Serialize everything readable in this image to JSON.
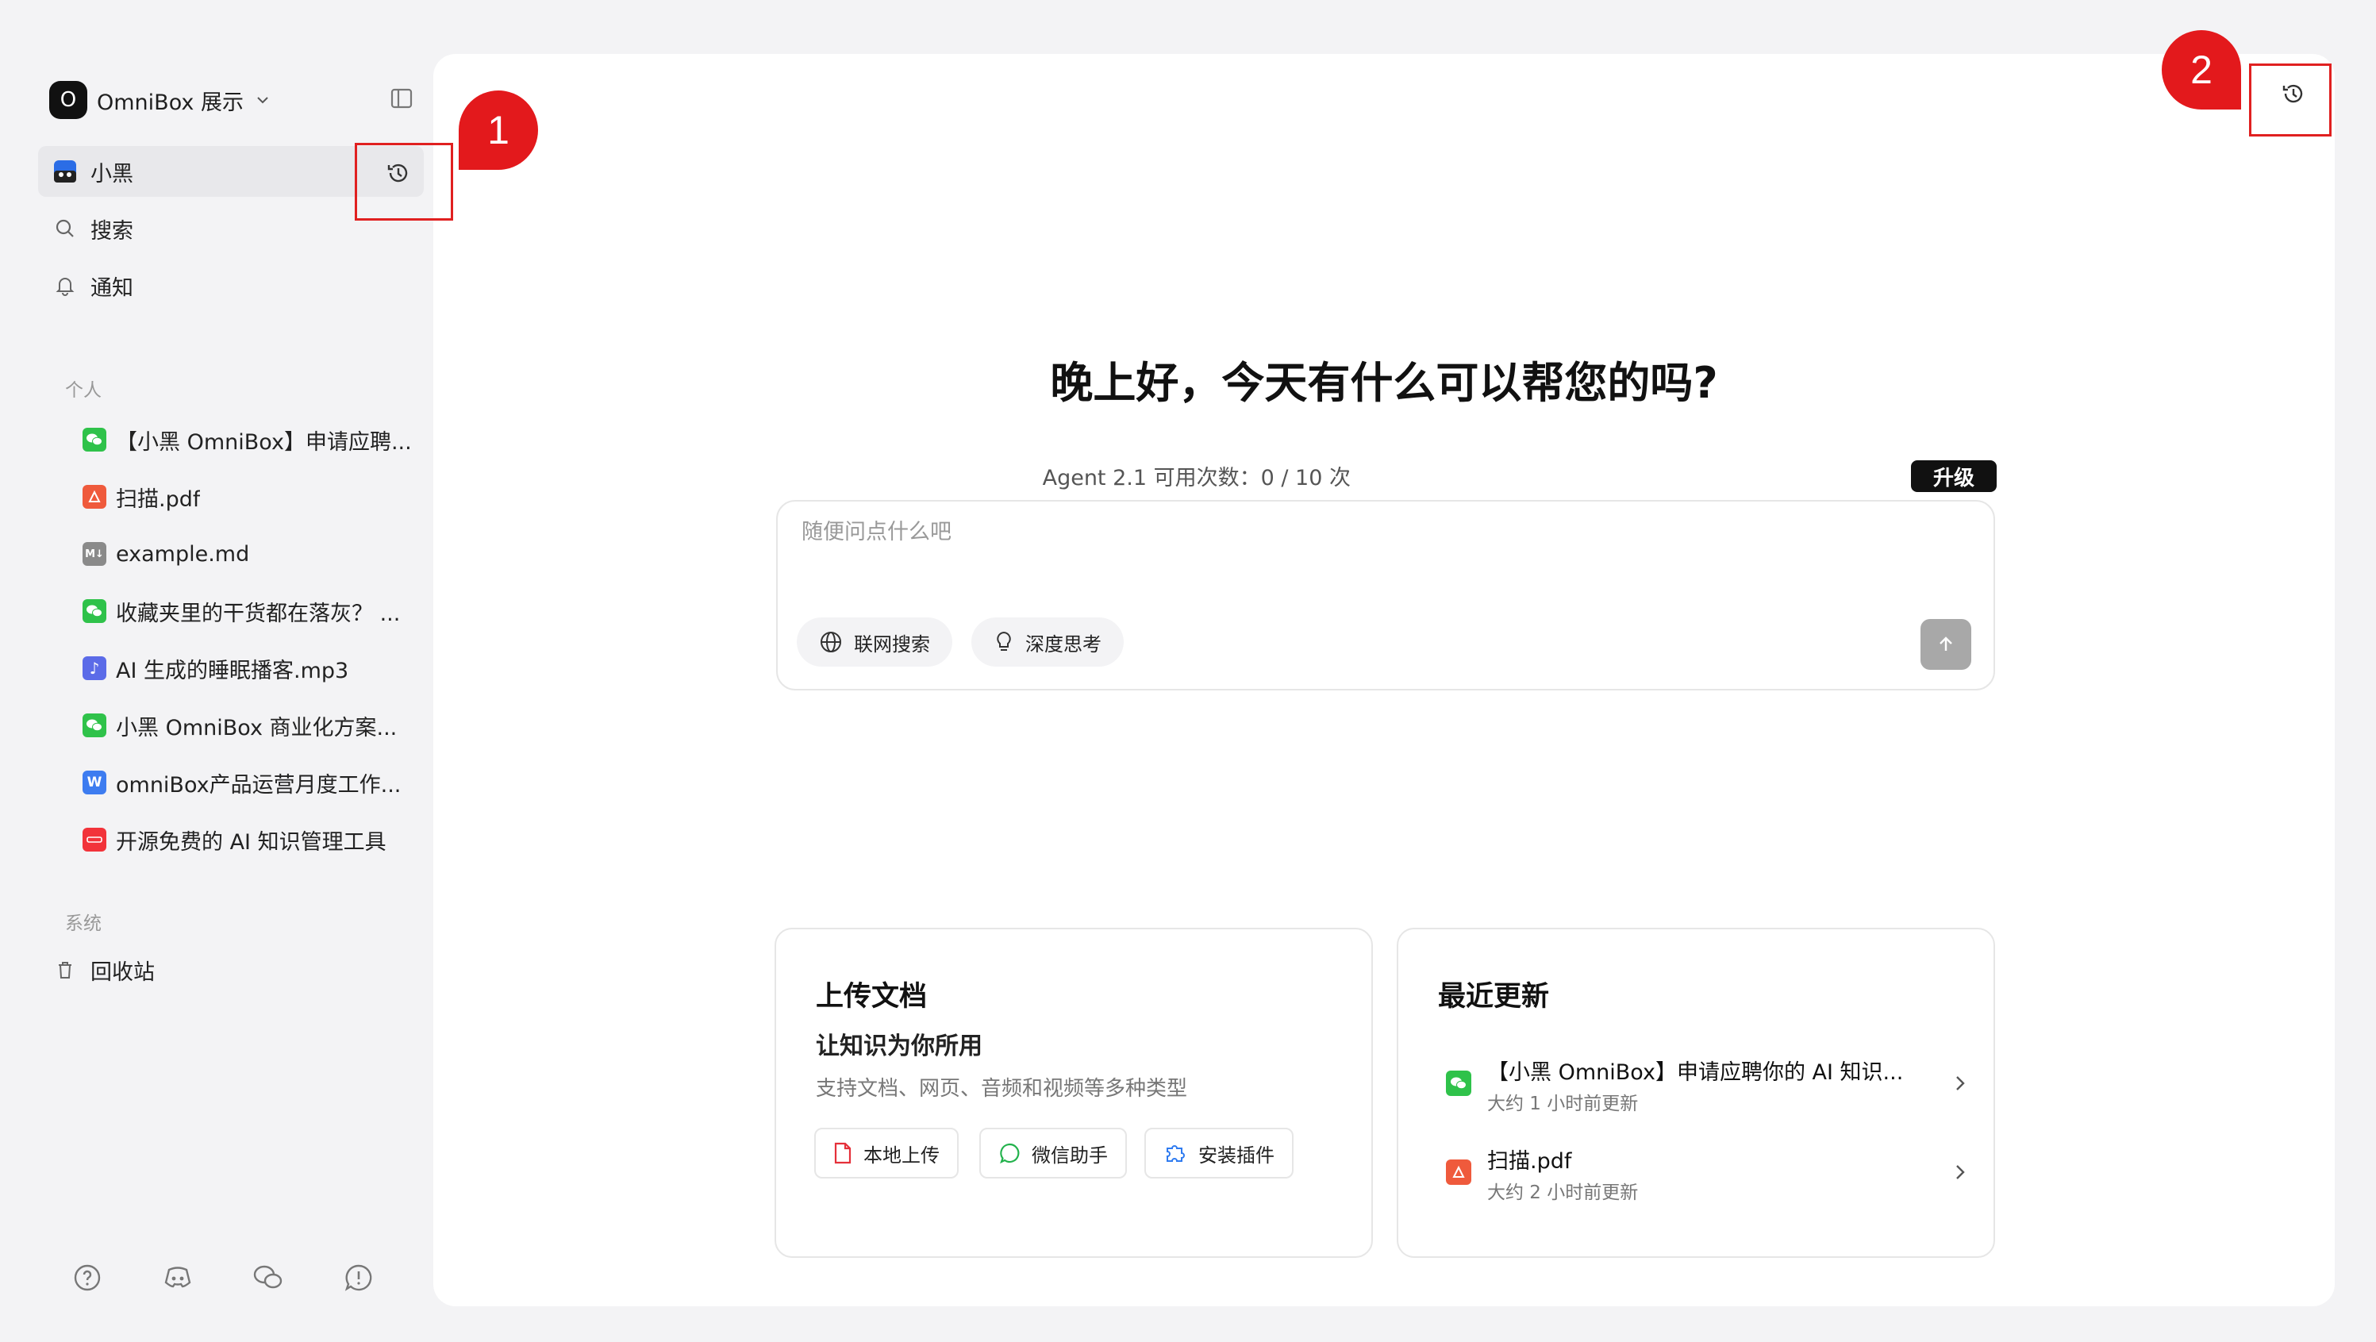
{
  "workspace": {
    "logo": "O",
    "name": "OmniBox 展示"
  },
  "nav": [
    {
      "label": "小黑",
      "icon": "avatar-icon"
    },
    {
      "label": "搜索",
      "icon": "search-icon"
    },
    {
      "label": "通知",
      "icon": "bell-icon"
    }
  ],
  "sections": {
    "personal": "个人",
    "system": "系统"
  },
  "documents": [
    {
      "label": "【小黑 OmniBox】申请应聘...",
      "icon": "wechat-icon"
    },
    {
      "label": "扫描.pdf",
      "icon": "pdf-icon"
    },
    {
      "label": "example.md",
      "icon": "markdown-icon"
    },
    {
      "label": "收藏夹里的干货都在落灰？ ...",
      "icon": "wechat-icon"
    },
    {
      "label": "AI 生成的睡眠播客.mp3",
      "icon": "audio-icon"
    },
    {
      "label": "小黑 OmniBox 商业化方案...",
      "icon": "wechat-icon"
    },
    {
      "label": "omniBox产品运营月度工作...",
      "icon": "word-icon"
    },
    {
      "label": "开源免费的 AI 知识管理工具",
      "icon": "web-icon"
    }
  ],
  "system_items": [
    {
      "label": "回收站",
      "icon": "trash-icon"
    }
  ],
  "callouts": {
    "one": "1",
    "two": "2"
  },
  "main": {
    "greeting": "晚上好，今天有什么可以帮您的吗?",
    "quota": "Agent 2.1 可用次数：0 / 10 次",
    "upgrade": "升级",
    "chat_placeholder": "随便问点什么吧",
    "web_search": "联网搜索",
    "deep_think": "深度思考"
  },
  "upload_card": {
    "title": "上传文档",
    "subtitle": "让知识为你所用",
    "desc": "支持文档、网页、音频和视频等多种类型",
    "local_upload": "本地上传",
    "wechat_helper": "微信助手",
    "install_plugin": "安装插件"
  },
  "recent_card": {
    "title": "最近更新",
    "items": [
      {
        "title": "【小黑 OmniBox】申请应聘你的 AI 知识...",
        "time": "大约 1 小时前更新",
        "icon": "wechat-icon"
      },
      {
        "title": "扫描.pdf",
        "time": "大约 2 小时前更新",
        "icon": "pdf-icon"
      }
    ]
  },
  "colors": {
    "wechat": "#2fc24a",
    "pdf": "#ef5a3c",
    "accent_red": "#e3191c"
  }
}
